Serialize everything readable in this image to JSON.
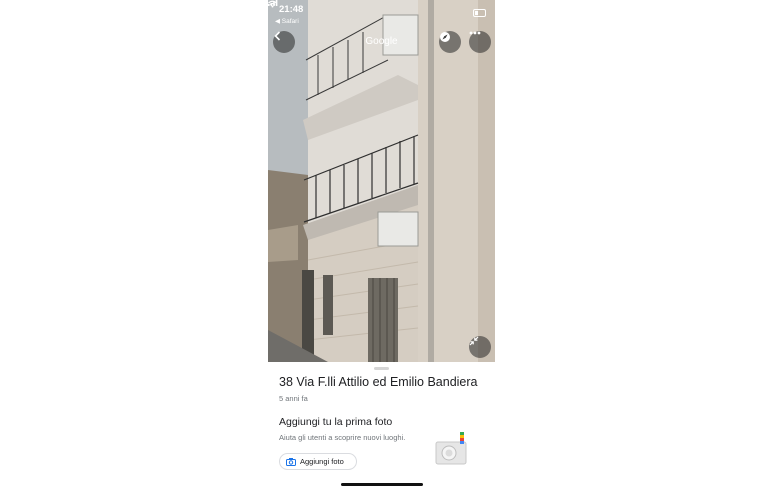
{
  "status_bar": {
    "time": "21:48",
    "back_app": "◀ Safari"
  },
  "header": {
    "title": "Google"
  },
  "icons": {
    "back": "chevron-left-icon",
    "compass": "compass-icon",
    "more": "more-horizontal-icon",
    "minimize": "collapse-icon",
    "camera": "camera-icon"
  },
  "place": {
    "address": "38 Via F.lli Attilio ed Emilio Bandiera",
    "age": "5 anni fa"
  },
  "photo_prompt": {
    "heading": "Aggiungi tu la prima foto",
    "description": "Aiuta gli utenti a scoprire nuovi luoghi.",
    "button_label": "Aggiungi foto"
  },
  "colors": {
    "accent": "#1a73e8",
    "text": "#202124",
    "secondary": "#70757a"
  }
}
